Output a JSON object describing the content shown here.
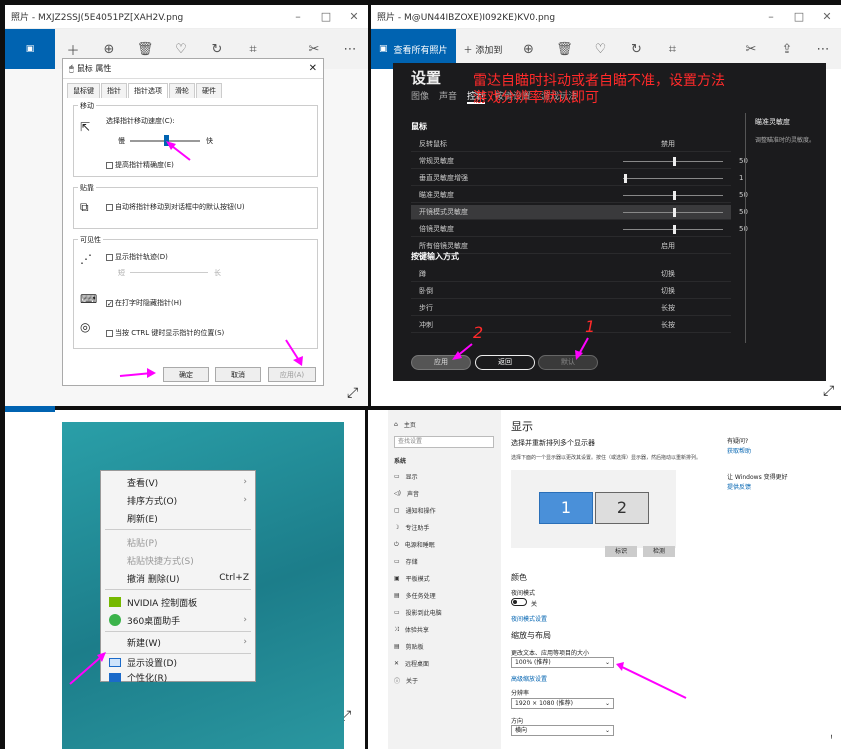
{
  "win1": {
    "title": "照片 - MXJZ2SSJ(5E4051PZ[XAH2V.png",
    "controls": [
      "–",
      "□",
      "✕"
    ]
  },
  "win2": {
    "title": "照片 - M@UN44IBZOXE)I092KE)KV0.png",
    "controls": [
      "–",
      "□",
      "✕"
    ],
    "see_all": "查看所有照片",
    "add_to": "添加到"
  },
  "mouse_dialog": {
    "title": "鼠标 属性",
    "tabs": [
      "鼠标键",
      "指针",
      "指针选项",
      "滑轮",
      "硬件"
    ],
    "move_group": "移动",
    "speed_label": "选择指针移动速度(C):",
    "slow": "慢",
    "fast": "快",
    "precision": "提高指针精确度(E)",
    "snap_group": "贴靠",
    "snap_label": "自动将指针移动到对话框中的默认按钮(U)",
    "vis_group": "可见性",
    "trails": "显示指针轨迹(D)",
    "short": "短",
    "long": "长",
    "hide_typing": "在打字时隐藏指针(H)",
    "ctrl_show": "当按 CTRL 键时显示指针的位置(S)",
    "ok": "确定",
    "cancel": "取消",
    "apply": "应用(A)"
  },
  "game": {
    "heading": "设置",
    "tabs": [
      "图像",
      "声音",
      "控制",
      "按键设置",
      "游戏玩法"
    ],
    "annotation_line1": "雷达自瞄时抖动或者自瞄不准，设置方法",
    "annotation_line2": "游戏分辨率默认即可",
    "mouse_section": "鼠标",
    "rows": [
      {
        "label": "反转鼠标",
        "value": "禁用"
      },
      {
        "label": "常规灵敏度",
        "value": "50"
      },
      {
        "label": "垂直灵敏度增强",
        "value": "1"
      },
      {
        "label": "瞄准灵敏度",
        "value": "50"
      },
      {
        "label": "开镜模式灵敏度",
        "value": "50"
      },
      {
        "label": "倍镜灵敏度",
        "value": "50"
      },
      {
        "label": "所有倍镜灵敏度",
        "value": "启用"
      }
    ],
    "keys_section": "按键输入方式",
    "key_rows": [
      {
        "label": "蹲",
        "value": "切换"
      },
      {
        "label": "卧倒",
        "value": "切换"
      },
      {
        "label": "步行",
        "value": "长按"
      },
      {
        "label": "冲刺",
        "value": "长按"
      }
    ],
    "side_title": "瞄准灵敏度",
    "side_desc": "调整瞄准时的灵敏度。",
    "btn_apply": "应用",
    "btn_back": "返回",
    "btn_default": "默认",
    "num1": "1",
    "num2": "2"
  },
  "context_menu": {
    "items": [
      {
        "label": "查看(V)",
        "arrow": "›"
      },
      {
        "label": "排序方式(O)",
        "arrow": "›"
      },
      {
        "label": "刷新(E)",
        "arrow": ""
      },
      {
        "label": "粘贴(P)",
        "arrow": ""
      },
      {
        "label": "粘贴快捷方式(S)",
        "arrow": ""
      },
      {
        "label": "撤消 删除(U)",
        "arrow": "",
        "shortcut": "Ctrl+Z"
      },
      {
        "label": "NVIDIA 控制面板",
        "arrow": ""
      },
      {
        "label": "360桌面助手",
        "arrow": "›"
      },
      {
        "label": "新建(W)",
        "arrow": "›"
      },
      {
        "label": "显示设置(D)",
        "arrow": ""
      },
      {
        "label": "个性化(R)",
        "arrow": ""
      }
    ]
  },
  "settings": {
    "home": "主页",
    "search": "查找设置",
    "system": "系统",
    "nav": [
      "显示",
      "声音",
      "通知和操作",
      "专注助手",
      "电源和睡眠",
      "存储",
      "平板模式",
      "多任务处理",
      "投影到此电脑",
      "体验共享",
      "剪贴板",
      "远程桌面",
      "关于"
    ],
    "title": "显示",
    "subtitle": "选择并重新排列多个显示器",
    "desc": "选择下面的一个显示器以更改其设置。按住（或选择）显示器，然后拖动以重新排列。",
    "mon1": "1",
    "mon2": "2",
    "identify": "标识",
    "detect": "检测",
    "color_h": "颜色",
    "night": "夜间模式",
    "off": "关",
    "night_link": "夜间模式设置",
    "scale_h": "缩放与布局",
    "scale_label": "更改文本、应用等项目的大小",
    "scale_val": "100% (推荐)",
    "adv_scale": "高级缩放设置",
    "res_label": "分辨率",
    "res_val": "1920 × 1080 (推荐)",
    "orient_label": "方向",
    "orient_val": "横向",
    "right1": "有疑问?",
    "right1_link": "获取帮助",
    "right2": "让 Windows 变得更好",
    "right2_link": "提供反馈"
  }
}
